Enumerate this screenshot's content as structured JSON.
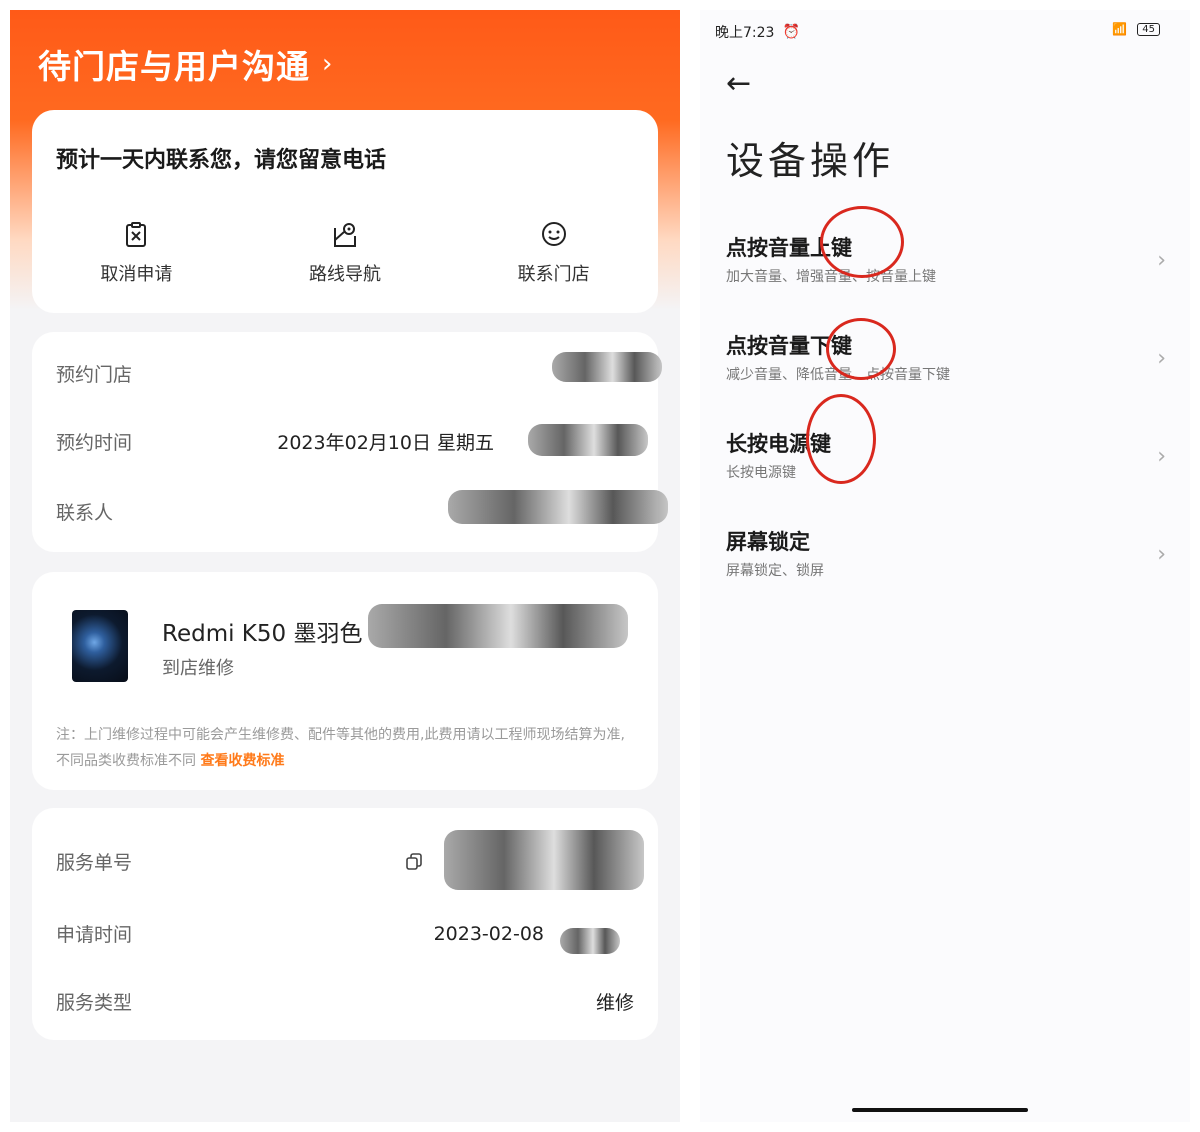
{
  "left": {
    "header_title": "待门店与用户沟通",
    "header_chevron": "›",
    "notice": "预计一天内联系您，请您留意电话",
    "actions": [
      {
        "label": "取消申请",
        "icon": "cancel-clipboard-icon"
      },
      {
        "label": "路线导航",
        "icon": "map-pin-icon"
      },
      {
        "label": "联系门店",
        "icon": "smile-chat-icon"
      }
    ],
    "info": {
      "store_label": "预约门店",
      "time_label": "预约时间",
      "time_value": "2023年02月10日 星期五",
      "contact_label": "联系人"
    },
    "product": {
      "name": "Redmi K50 墨羽色",
      "service": "到店维修",
      "note": "注：上门维修过程中可能会产生维修费、配件等其他的费用,此费用请以工程师现场结算为准,不同品类收费标准不同",
      "note_link": "查看收费标准"
    },
    "service": {
      "order_label": "服务单号",
      "apply_label": "申请时间",
      "apply_value": "2023-02-08",
      "type_label": "服务类型",
      "type_value": "维修"
    }
  },
  "right": {
    "status_time": "晚上7:23",
    "battery": "45",
    "back": "←",
    "title": "设备操作",
    "items": [
      {
        "title": "点按音量上键",
        "sub": "加大音量、增强音量、按音量上键"
      },
      {
        "title": "点按音量下键",
        "sub": "减少音量、降低音量、点按音量下键"
      },
      {
        "title": "长按电源键",
        "sub": "长按电源键"
      },
      {
        "title": "屏幕锁定",
        "sub": "屏幕锁定、锁屏"
      }
    ],
    "chevron": "›"
  },
  "colors": {
    "header_orange": "#ff5a18",
    "link_orange": "#ff7a1a",
    "annotation_red": "#d9281e"
  }
}
